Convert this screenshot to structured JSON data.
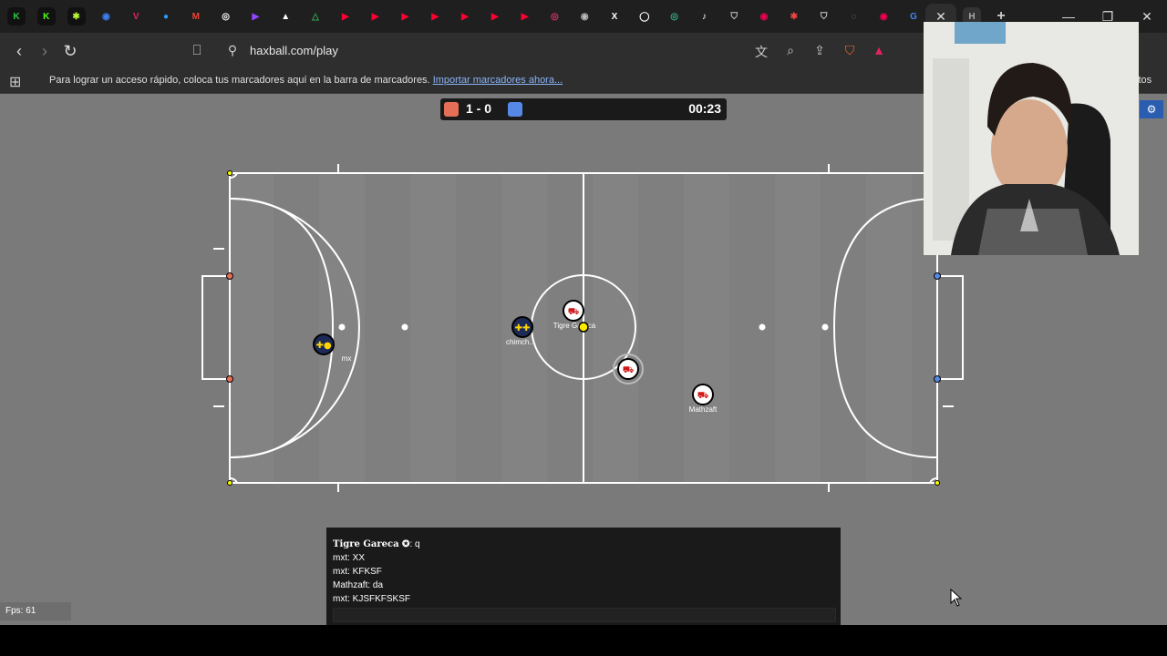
{
  "browser": {
    "tabs": [
      {
        "icon": "K",
        "color": "#2ecc40",
        "bg": "#111"
      },
      {
        "icon": "K",
        "color": "#53fc18",
        "bg": "#111"
      },
      {
        "icon": "✱",
        "color": "#b8f53b",
        "bg": "#111"
      },
      {
        "icon": "◉",
        "color": "#3b82f6",
        "bg": "#1f1f1f"
      },
      {
        "icon": "V",
        "color": "#e0245e",
        "bg": "#1f1f1f"
      },
      {
        "icon": "●",
        "color": "#2f9bff",
        "bg": "#1f1f1f"
      },
      {
        "icon": "M",
        "color": "#ea4335",
        "bg": "#1f1f1f"
      },
      {
        "icon": "◎",
        "color": "#fff",
        "bg": "#1f1f1f"
      },
      {
        "icon": "▶",
        "color": "#9146ff",
        "bg": "#1f1f1f"
      },
      {
        "icon": "▲",
        "color": "#ffffff",
        "bg": "#1f1f1f"
      },
      {
        "icon": "△",
        "color": "#34a853",
        "bg": "#1f1f1f"
      },
      {
        "icon": "▶",
        "color": "#ff0033",
        "bg": "#1f1f1f"
      },
      {
        "icon": "▶",
        "color": "#ff0033",
        "bg": "#1f1f1f"
      },
      {
        "icon": "▶",
        "color": "#ff0033",
        "bg": "#1f1f1f"
      },
      {
        "icon": "▶",
        "color": "#ff0033",
        "bg": "#1f1f1f"
      },
      {
        "icon": "▶",
        "color": "#ff0033",
        "bg": "#1f1f1f"
      },
      {
        "icon": "▶",
        "color": "#ff0033",
        "bg": "#1f1f1f"
      },
      {
        "icon": "▶",
        "color": "#ff0033",
        "bg": "#1f1f1f"
      },
      {
        "icon": "◎",
        "color": "#e1306c",
        "bg": "#1f1f1f"
      },
      {
        "icon": "◉",
        "color": "#bbb",
        "bg": "#1f1f1f"
      },
      {
        "icon": "X",
        "color": "#fff",
        "bg": "#1f1f1f"
      },
      {
        "icon": "◯",
        "color": "#fff",
        "bg": "#1f1f1f"
      },
      {
        "icon": "◎",
        "color": "#3a8",
        "bg": "#1f1f1f"
      },
      {
        "icon": "♪",
        "color": "#fff",
        "bg": "#1f1f1f"
      },
      {
        "icon": "⛉",
        "color": "#ccc",
        "bg": "#1f1f1f"
      },
      {
        "icon": "◉",
        "color": "#e05",
        "bg": "#1f1f1f"
      },
      {
        "icon": "✱",
        "color": "#e44",
        "bg": "#1f1f1f"
      },
      {
        "icon": "⛉",
        "color": "#ccc",
        "bg": "#1f1f1f"
      },
      {
        "icon": "◌",
        "color": "#888",
        "bg": "#1f1f1f"
      },
      {
        "icon": "◉",
        "color": "#e05",
        "bg": "#1f1f1f"
      },
      {
        "icon": "G",
        "color": "#4285f4",
        "bg": "#1f1f1f"
      }
    ],
    "active_tab_close": "✕",
    "active_tab_label": "H",
    "new_tab": "+",
    "window": {
      "minimize": "—",
      "maximize": "❐",
      "close": "✕"
    },
    "url": "haxball.com/play",
    "bookmarks_prompt": "Para lograr un acceso rápido, coloca tus marcadores aquí en la barra de marcadores.",
    "bookmarks_import": "Importar marcadores ahora...",
    "bookmarks_right": "itos"
  },
  "game": {
    "score": "1 - 0",
    "red_color": "#e56e56",
    "blue_color": "#5689e5",
    "time": "00:23",
    "settings_icon": "⚙",
    "fps_label": "Fps: 61",
    "players": [
      {
        "team": "blue",
        "avatar": "✚●",
        "name": "mx"
      },
      {
        "team": "blue",
        "avatar": "✚✚",
        "name": "chimch..."
      },
      {
        "team": "red",
        "avatar": "⛟",
        "name": "Tigre Gareca"
      },
      {
        "team": "red",
        "avatar": "⛟",
        "name": ""
      },
      {
        "team": "red",
        "avatar": "⛟",
        "name": "Mathzaft"
      }
    ],
    "chat": [
      {
        "name": "Tigre Gareca",
        "name_icon": "✪",
        "text": ": q",
        "bold": true
      },
      {
        "name": "mxt",
        "name_icon": "",
        "text": ": XX",
        "bold": false
      },
      {
        "name": "mxt",
        "name_icon": "",
        "text": ": KFKSF",
        "bold": false
      },
      {
        "name": "Mathzaft",
        "name_icon": "",
        "text": ": da",
        "bold": false
      },
      {
        "name": "mxt",
        "name_icon": "",
        "text": ": KJSFKFSKSF",
        "bold": false
      }
    ]
  }
}
